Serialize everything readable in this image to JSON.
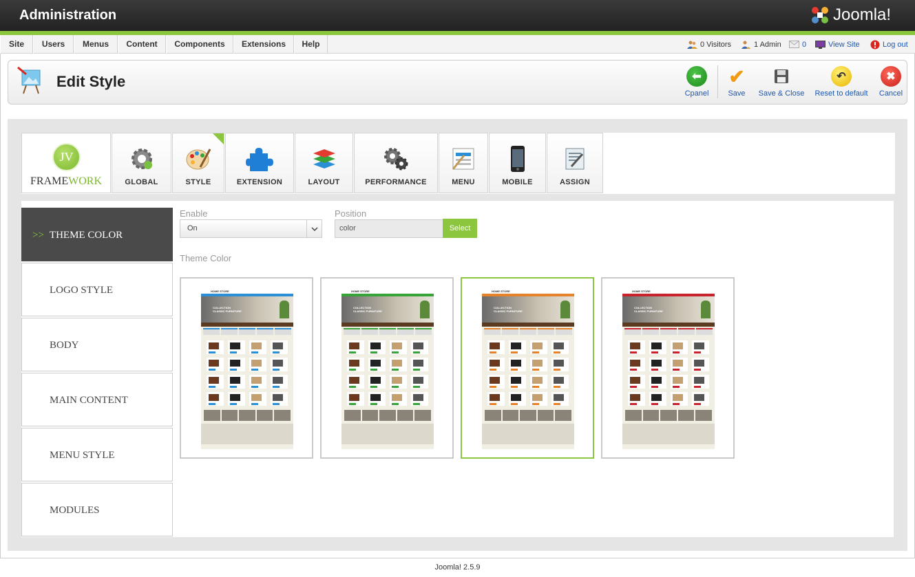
{
  "header": {
    "title": "Administration",
    "brand": "Joomla!"
  },
  "menu": [
    "Site",
    "Users",
    "Menus",
    "Content",
    "Components",
    "Extensions",
    "Help"
  ],
  "status": {
    "visitors": "0 Visitors",
    "admins": "1 Admin",
    "messages": "0",
    "view_site": "View Site",
    "logout": "Log out"
  },
  "toolbar": {
    "page_title": "Edit Style",
    "cpanel": "Cpanel",
    "save": "Save",
    "save_close": "Save & Close",
    "reset": "Reset to default",
    "cancel": "Cancel"
  },
  "framework": {
    "badge": "JV",
    "name_a": "FRAME",
    "name_b": "WORK"
  },
  "tabs": [
    "GLOBAL",
    "STYLE",
    "EXTENSION",
    "LAYOUT",
    "PERFORMANCE",
    "MENU",
    "MOBILE",
    "ASSIGN"
  ],
  "active_tab": "STYLE",
  "sidebar": {
    "active_prefix": ">>",
    "items": [
      "THEME COLOR",
      "LOGO STYLE",
      "BODY",
      "MAIN CONTENT",
      "MENU STYLE",
      "MODULES"
    ]
  },
  "form": {
    "enable_label": "Enable",
    "enable_value": "On",
    "position_label": "Position",
    "position_value": "color",
    "select_button": "Select",
    "theme_color_label": "Theme Color"
  },
  "themes": [
    {
      "name": "blue",
      "accent": "#2b8fd8",
      "selected": false
    },
    {
      "name": "green",
      "accent": "#37a43a",
      "selected": false
    },
    {
      "name": "orange",
      "accent": "#e6832a",
      "selected": true
    },
    {
      "name": "red",
      "accent": "#c8232c",
      "selected": false
    }
  ],
  "thumb_text": {
    "store": "HOME STORE",
    "line1": "COLLECTION",
    "line2": "CLASSIC FURNITURE"
  },
  "footer": "Joomla! 2.5.9",
  "colors": {
    "green": "#8cc63f",
    "dark": "#4a4a4a",
    "link": "#1b57b1"
  }
}
